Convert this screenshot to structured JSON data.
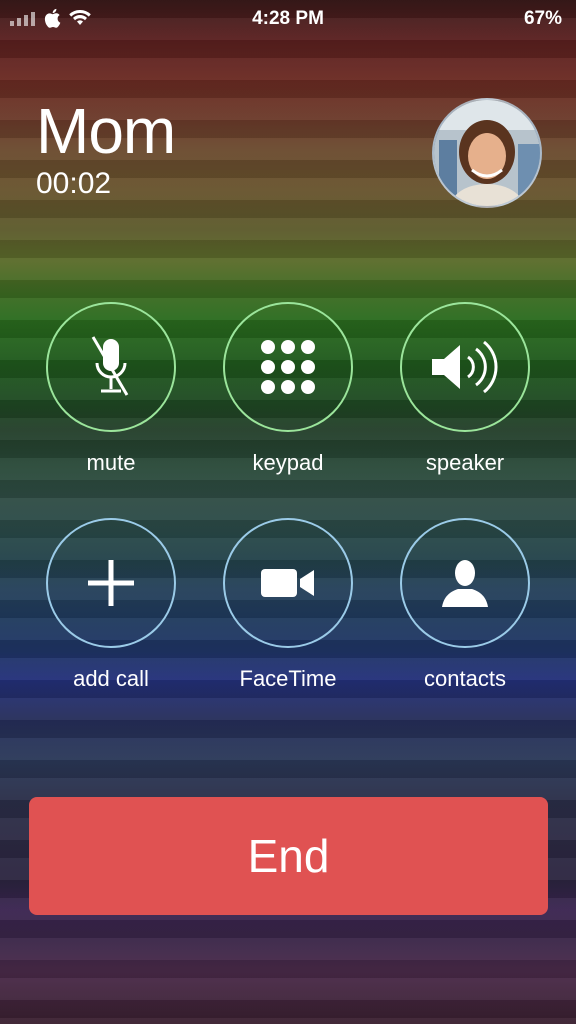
{
  "status_bar": {
    "time": "4:28 PM",
    "battery": "67%"
  },
  "call": {
    "name": "Mom",
    "duration": "00:02"
  },
  "controls": [
    {
      "label": "mute",
      "icon": "microphone-muted-icon"
    },
    {
      "label": "keypad",
      "icon": "keypad-icon"
    },
    {
      "label": "speaker",
      "icon": "speaker-icon"
    },
    {
      "label": "add call",
      "icon": "plus-icon"
    },
    {
      "label": "FaceTime",
      "icon": "video-camera-icon"
    },
    {
      "label": "contacts",
      "icon": "contact-person-icon"
    }
  ],
  "end_button": {
    "label": "End"
  },
  "colors": {
    "end_red": "#e05252",
    "ring_green": "#9be59b",
    "ring_blue": "#9bcbe8"
  }
}
